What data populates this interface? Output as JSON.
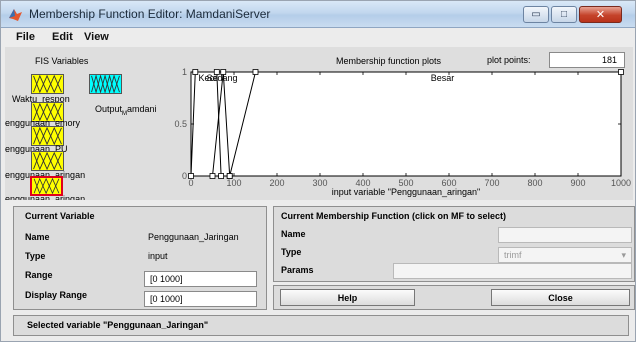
{
  "window": {
    "title": "Membership Function Editor: MamdaniServer",
    "controls": {
      "minimize": "▭",
      "maximize": "□",
      "close": "✕"
    }
  },
  "menu": [
    "File",
    "Edit",
    "View"
  ],
  "fis_variables": {
    "label": "FIS Variables",
    "inputs": [
      "Waktu_respon",
      "Penggunaan_Memory",
      "Penggunaan_PU",
      "Penggunaan_Jaringan"
    ],
    "output_label": "Output",
    "output_subscript": "M",
    "output_suffix": "amdani",
    "visible_labels": [
      "Waktu_respon",
      "enggunaan_emory",
      "enggunaan_PU",
      "enggunaan_aringan"
    ],
    "partial_label": "enggunaan_aringan",
    "selected_color": "#e0001b",
    "input_color": "#ffff00",
    "output_color": "#00ffff"
  },
  "plot": {
    "title": "Membership function plots",
    "plot_points_label": "plot points:",
    "plot_points_value": "181",
    "xlabel": "input variable \"Penggunaan_aringan\""
  },
  "chart_data": {
    "type": "line",
    "xlim": [
      0,
      1000
    ],
    "ylim": [
      0,
      1
    ],
    "x_ticks": [
      "0",
      "100",
      "200",
      "300",
      "400",
      "500",
      "600",
      "700",
      "800",
      "900",
      "1000"
    ],
    "y_ticks": [
      "0",
      "0.5",
      "1"
    ],
    "series": [
      {
        "name": "Kecil",
        "points": [
          [
            0,
            0
          ],
          [
            10,
            1
          ],
          [
            60,
            1
          ],
          [
            70,
            0
          ]
        ]
      },
      {
        "name": "Sedang",
        "points": [
          [
            50,
            0
          ],
          [
            75,
            1
          ],
          [
            90,
            0
          ]
        ]
      },
      {
        "name": "Besar",
        "points": [
          [
            90,
            0
          ],
          [
            150,
            1
          ],
          [
            1000,
            1
          ]
        ]
      }
    ],
    "labels": [
      {
        "text": "Kecil",
        "x": 40
      },
      {
        "text": "Sedang",
        "x": 72
      },
      {
        "text": "Besar",
        "x": 585
      }
    ],
    "grid": false
  },
  "current_variable": {
    "heading": "Current Variable",
    "name_label": "Name",
    "name_value": "Penggunaan_Jaringan",
    "type_label": "Type",
    "type_value": "input",
    "range_label": "Range",
    "range_value": "[0 1000]",
    "display_range_label": "Display Range",
    "display_range_value": "[0 1000]"
  },
  "current_mf": {
    "heading": "Current Membership Function (click on MF to select)",
    "name_label": "Name",
    "type_label": "Type",
    "type_value": "trimf",
    "params_label": "Params",
    "dropdown_arrow": "▾"
  },
  "buttons": {
    "help": "Help",
    "close": "Close"
  },
  "status": "Selected variable \"Penggunaan_Jaringan\""
}
